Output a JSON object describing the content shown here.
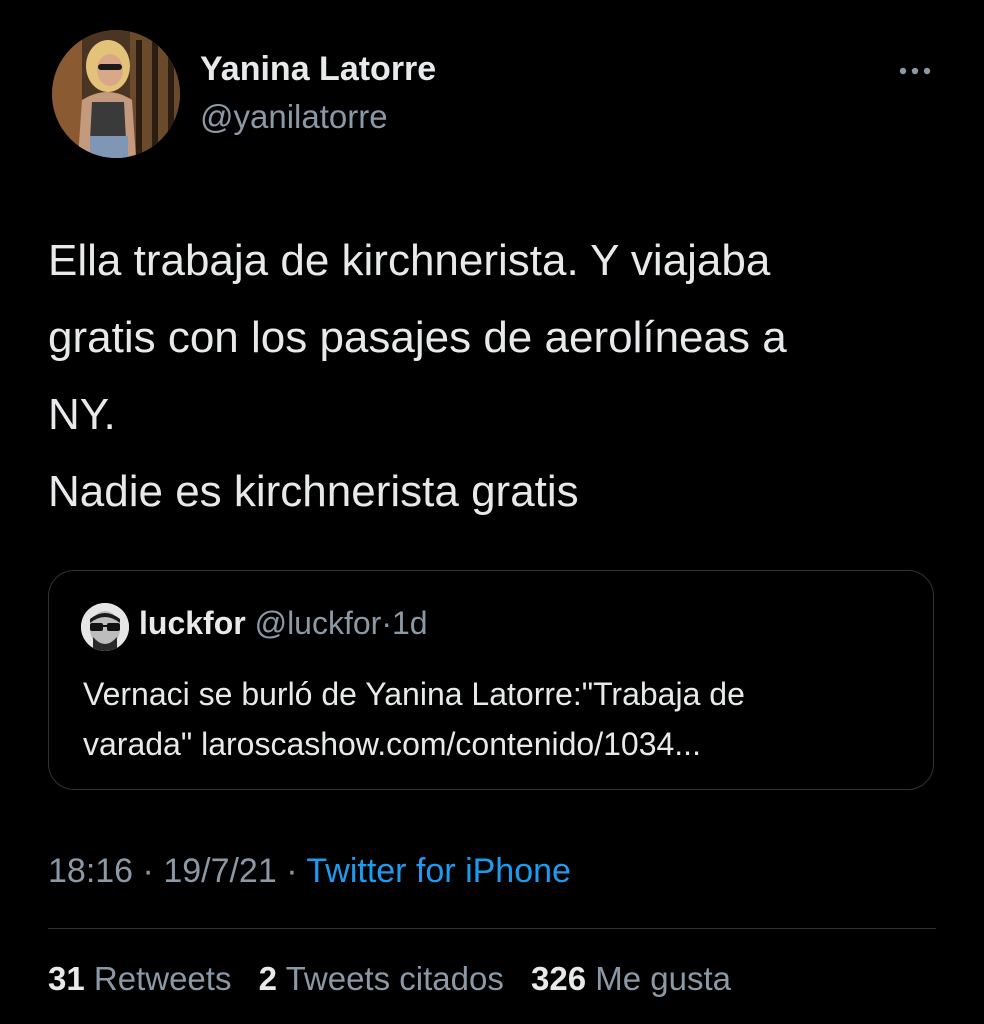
{
  "author": {
    "name": "Yanina Latorre",
    "handle": "@yanilatorre"
  },
  "more_icon": "ellipsis-icon",
  "tweet": {
    "lines": [
      "Ella trabaja de kirchnerista. Y viajaba",
      "gratis con los pasajes de aerolíneas a",
      "NY.",
      "Nadie es kirchnerista gratis"
    ]
  },
  "quote": {
    "name": "luckfor",
    "handle": "@luckfor",
    "separator": "·",
    "time": "1d",
    "lines": [
      "Vernaci se burló de Yanina Latorre:\"Trabaja de",
      "varada\" laroscashow.com/contenido/1034..."
    ]
  },
  "meta": {
    "time": "18:16",
    "sep1": " · ",
    "date": "19/7/21",
    "sep2": " · ",
    "source": "Twitter for iPhone"
  },
  "stats": [
    {
      "count": "31",
      "label": "Retweets"
    },
    {
      "count": "2",
      "label": "Tweets citados"
    },
    {
      "count": "326",
      "label": "Me gusta"
    }
  ],
  "colors": {
    "background": "#000000",
    "text": "#e7e9ea",
    "secondary": "#8b98a5",
    "link": "#1d9bf0",
    "border": "#2f3336"
  }
}
